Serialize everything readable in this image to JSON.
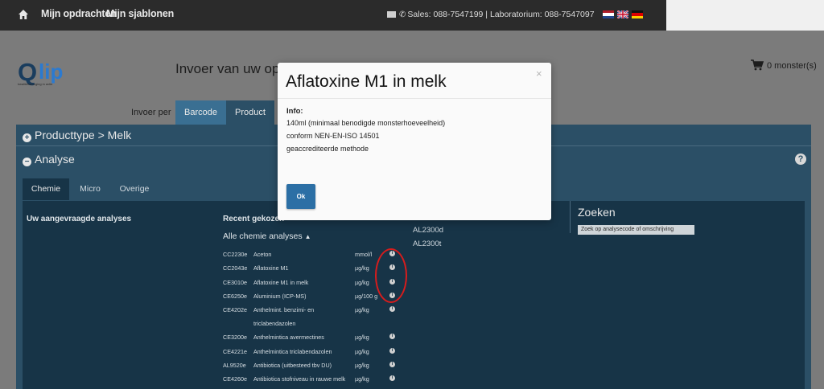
{
  "topbar": {
    "nav": [
      "Mijn opdrachten",
      "Mijn sjablonen"
    ],
    "contact": "Sales: 088-7547199 | Laboratorium: 088-7547097",
    "icons": {
      "home": "home-icon",
      "mail": "mail-icon",
      "phone": "phone-icon"
    },
    "flags": [
      "flag-nl-icon",
      "flag-uk-icon",
      "flag-de-icon"
    ]
  },
  "header": {
    "logo_q": "Q",
    "logo_lip": "lip",
    "logo_tag": "kwaliteitsborging in actie",
    "title": "Invoer van uw opdracht",
    "cart": "0 monster(s)"
  },
  "invoer": {
    "label": "Invoer per",
    "tabs": [
      "Barcode",
      "Product"
    ]
  },
  "panel": {
    "producttype": "Producttype > Melk",
    "analyse": "Analyse",
    "subtabs": [
      "Chemie",
      "Micro",
      "Overige"
    ],
    "left_heading": "Uw aangevraagde analyses",
    "recent_heading": "Recent gekozen",
    "alle": "Alle chemie analyses",
    "rows": [
      {
        "code": "CC2230e",
        "name": "Aceton",
        "unit": "mmol/l"
      },
      {
        "code": "CC2043e",
        "name": "Aflatoxine M1",
        "unit": "µg/kg"
      },
      {
        "code": "CE3010e",
        "name": "Aflatoxine M1 in melk",
        "unit": "µg/kg"
      },
      {
        "code": "CE6250e",
        "name": "Aluminium (ICP-MS)",
        "unit": "µg/100 g"
      },
      {
        "code": "CE4202e",
        "name": "Anthelmint. benzimi- en",
        "unit": "µg/kg"
      },
      {
        "code": "",
        "name": "triclabendazolen",
        "unit": ""
      },
      {
        "code": "CE3200e",
        "name": "Anthelmintica avermectines",
        "unit": "µg/kg"
      },
      {
        "code": "CE4221e",
        "name": "Anthelmintica triclabendazolen",
        "unit": "µg/kg"
      },
      {
        "code": "AL9520e",
        "name": "Antibiotica (uitbesteed tbv DU)",
        "unit": "µg/kg"
      },
      {
        "code": "CE4260e",
        "name": "Antibiotica stofniveau in rauwe melk",
        "unit": "µg/kg"
      }
    ],
    "al_codes": [
      "AL2300d",
      "AL2300t"
    ],
    "zoeken": "Zoeken",
    "zoek_placeholder": "Zoek op analysecode of omschrijving"
  },
  "modal": {
    "title": "Aflatoxine M1 in melk",
    "info_heading": "Info:",
    "lines": [
      "140ml (minimaal benodigde monsterhoeveelheid)",
      "conform NEN-EN-ISO 14501",
      "geaccrediteerde methode"
    ],
    "ok": "Ok",
    "close": "×"
  },
  "colors": {
    "accent": "#2c6fa5",
    "annotation": "#d81c1c",
    "panel": "#2b4f66"
  }
}
